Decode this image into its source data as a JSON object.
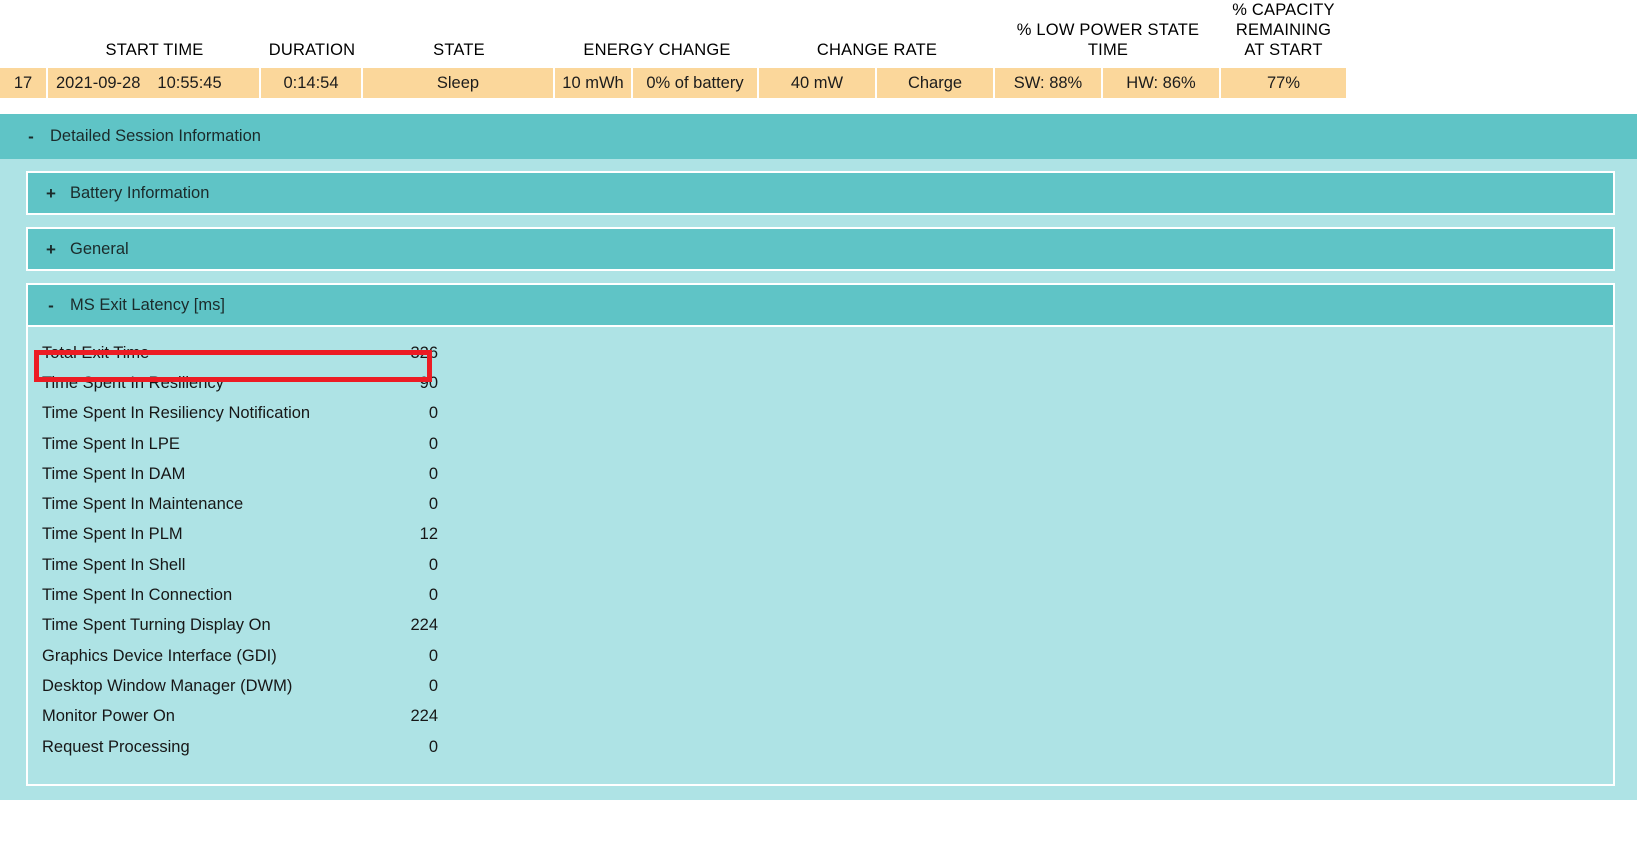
{
  "session_table": {
    "columns": [
      {
        "key": "index",
        "header": ""
      },
      {
        "key": "start_time",
        "header": "START TIME"
      },
      {
        "key": "duration",
        "header": "DURATION"
      },
      {
        "key": "state",
        "header": "STATE"
      },
      {
        "key": "energy_change",
        "header": "ENERGY CHANGE"
      },
      {
        "key": "energy_change_pct",
        "header": ""
      },
      {
        "key": "change_rate",
        "header": "CHANGE RATE"
      },
      {
        "key": "change_direction",
        "header": ""
      },
      {
        "key": "low_power_sw",
        "header": "% LOW POWER STATE TIME"
      },
      {
        "key": "low_power_hw",
        "header": ""
      },
      {
        "key": "capacity_remaining",
        "header": "% CAPACITY REMAINING AT START"
      }
    ],
    "headers": {
      "start_time": "START TIME",
      "duration": "DURATION",
      "state": "STATE",
      "energy_change": "ENERGY CHANGE",
      "change_rate": "CHANGE RATE",
      "low_power_state_time": "% LOW POWER STATE TIME",
      "capacity_remaining_line1": "% CAPACITY",
      "capacity_remaining_line2": "REMAINING",
      "capacity_remaining_line3": "AT START"
    },
    "row": {
      "index": "17",
      "date": "2021-09-28",
      "time": "10:55:45",
      "duration": "0:14:54",
      "state": "Sleep",
      "energy_change": "10 mWh",
      "energy_change_pct": "0% of battery",
      "change_rate": "40 mW",
      "change_direction": "Charge",
      "low_power_sw": "SW: 88%",
      "low_power_hw": "HW: 86%",
      "capacity_remaining": "77%"
    }
  },
  "detailed_session": {
    "title": "Detailed Session Information",
    "toggle": "-",
    "expanded": true,
    "sections": [
      {
        "title": "Battery Information",
        "toggle": "+",
        "expanded": false
      },
      {
        "title": "General",
        "toggle": "+",
        "expanded": false
      },
      {
        "title": "MS Exit Latency [ms]",
        "toggle": "-",
        "expanded": true
      }
    ]
  },
  "ms_exit_latency": {
    "title": "MS Exit Latency [ms]",
    "unit": "ms",
    "metrics": [
      {
        "label": "Total Exit Time",
        "value": "326",
        "highlighted": true
      },
      {
        "label": "Time Spent In Resiliency",
        "value": "90",
        "highlighted": false
      },
      {
        "label": "Time Spent In Resiliency Notification",
        "value": "0",
        "highlighted": false
      },
      {
        "label": "Time Spent In LPE",
        "value": "0",
        "highlighted": false
      },
      {
        "label": "Time Spent In DAM",
        "value": "0",
        "highlighted": false
      },
      {
        "label": "Time Spent In Maintenance",
        "value": "0",
        "highlighted": false
      },
      {
        "label": "Time Spent In PLM",
        "value": "12",
        "highlighted": false
      },
      {
        "label": "Time Spent In Shell",
        "value": "0",
        "highlighted": false
      },
      {
        "label": "Time Spent In Connection",
        "value": "0",
        "highlighted": false
      },
      {
        "label": "Time Spent Turning Display On",
        "value": "224",
        "highlighted": false
      },
      {
        "label": "Graphics Device Interface (GDI)",
        "value": "0",
        "highlighted": false
      },
      {
        "label": "Desktop Window Manager (DWM)",
        "value": "0",
        "highlighted": false
      },
      {
        "label": "Monitor Power On",
        "value": "224",
        "highlighted": false
      },
      {
        "label": "Request Processing",
        "value": "0",
        "highlighted": false
      }
    ]
  },
  "annotation": {
    "type": "highlight-rectangle",
    "target": "Total Exit Time",
    "color": "#ec1c24"
  },
  "colors": {
    "row_background": "#fbd79b",
    "section_header": "#5fc4c6",
    "section_body": "#aee3e5",
    "page_background": "#ffffff",
    "text": "#171717",
    "annotation": "#ec1c24"
  }
}
